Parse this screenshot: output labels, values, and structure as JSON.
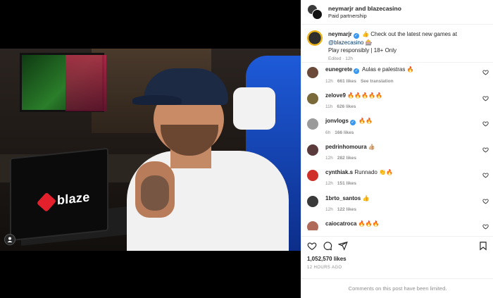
{
  "header": {
    "title": "neymarjr and blazecasino",
    "subtitle": "Paid partnership"
  },
  "caption": {
    "username": "neymarjr",
    "text_part1": "👍 Check out the latest new games at",
    "mention": "@blazecasino 🎰",
    "text_part2": "Play responsibly | 18+ Only",
    "meta": "Edited · 12h"
  },
  "media": {
    "laptop_brand": "blaze"
  },
  "comments": [
    {
      "username": "eunegrete",
      "verified": true,
      "text": "Aulas e palestras 🔥",
      "time": "12h",
      "likes": "661 likes",
      "extra": "See translation",
      "avatar_color": "#6b4a3a"
    },
    {
      "username": "zelove9",
      "verified": false,
      "text": "🔥🔥🔥🔥🔥",
      "time": "11h",
      "likes": "626 likes",
      "extra": "",
      "avatar_color": "#7a6a3a"
    },
    {
      "username": "jonvlogs",
      "verified": true,
      "text": "🔥🔥",
      "time": "6h",
      "likes": "166 likes",
      "extra": "",
      "avatar_color": "#9a9a9a"
    },
    {
      "username": "pedrinhomoura",
      "verified": false,
      "text": "👍🏼",
      "time": "12h",
      "likes": "282 likes",
      "extra": "",
      "avatar_color": "#5a3a3a"
    },
    {
      "username": "cynthiak.s",
      "verified": false,
      "text": "Runnado 👏🔥",
      "time": "12h",
      "likes": "151 likes",
      "extra": "",
      "avatar_color": "#d0302a"
    },
    {
      "username": "1brto_santos",
      "verified": false,
      "text": "👍",
      "time": "12h",
      "likes": "122 likes",
      "extra": "",
      "avatar_color": "#3a3a3a"
    },
    {
      "username": "caiocatroca",
      "verified": false,
      "text": "🔥🔥🔥",
      "time": "",
      "likes": "",
      "extra": "",
      "avatar_color": "#b06a5a"
    }
  ],
  "stats": {
    "likes_total": "1,052,570 likes",
    "time_ago": "12 HOURS AGO"
  },
  "footer": {
    "limited_text": "Comments on this post have been limited."
  },
  "icons": {
    "heart": "heart-icon",
    "comment": "comment-icon",
    "share": "share-icon",
    "save": "bookmark-icon"
  }
}
